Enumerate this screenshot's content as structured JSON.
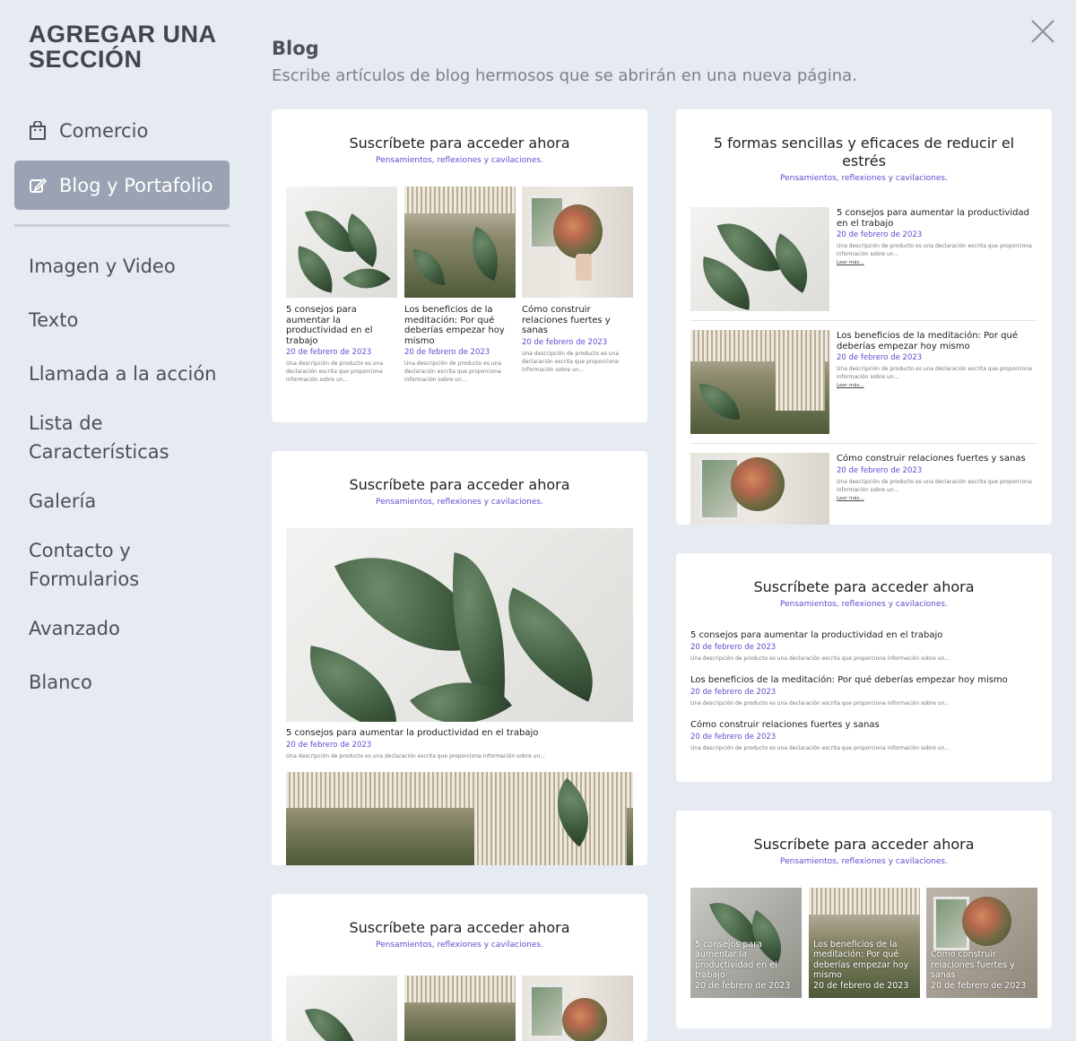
{
  "sidebar": {
    "title": "AGREGAR UNA SECCIÓN",
    "items": [
      {
        "label": "Comercio",
        "icon": "shopping-bag-icon"
      },
      {
        "label": "Blog y Portafolio",
        "icon": "edit-icon",
        "active": true
      },
      {
        "label": "Imagen y Video"
      },
      {
        "label": "Texto"
      },
      {
        "label": "Llamada a la acción"
      },
      {
        "label": "Lista de Características"
      },
      {
        "label": "Galería"
      },
      {
        "label": "Contacto y Formularios"
      },
      {
        "label": "Avanzado"
      },
      {
        "label": "Blanco"
      }
    ]
  },
  "header": {
    "title": "Blog",
    "subtitle": "Escribe artículos de blog hermosos que se abrirán en una nueva página.",
    "close_icon": "close-icon"
  },
  "templates": {
    "subscribe_title": "Suscríbete para acceder ahora",
    "subscribe_sub": "Pensamientos, reflexiones y cavilaciones.",
    "stress_title": "5 formas sencillas y eficaces de reducir el estrés",
    "date": "20 de febrero de 2023",
    "desc": "Una descripción de producto es una declaración escrita que proporciona información sobre un...",
    "more": "Leer más...",
    "posts": [
      "5 consejos para aumentar la productividad en el trabajo",
      "Los beneficios de la meditación: Por qué deberías empezar hoy mismo",
      "Cómo construir relaciones fuertes y sanas"
    ]
  },
  "colors": {
    "background": "#e6eaf1",
    "active_nav": "#9aa3b3",
    "accent_link": "#5a4fd0"
  }
}
